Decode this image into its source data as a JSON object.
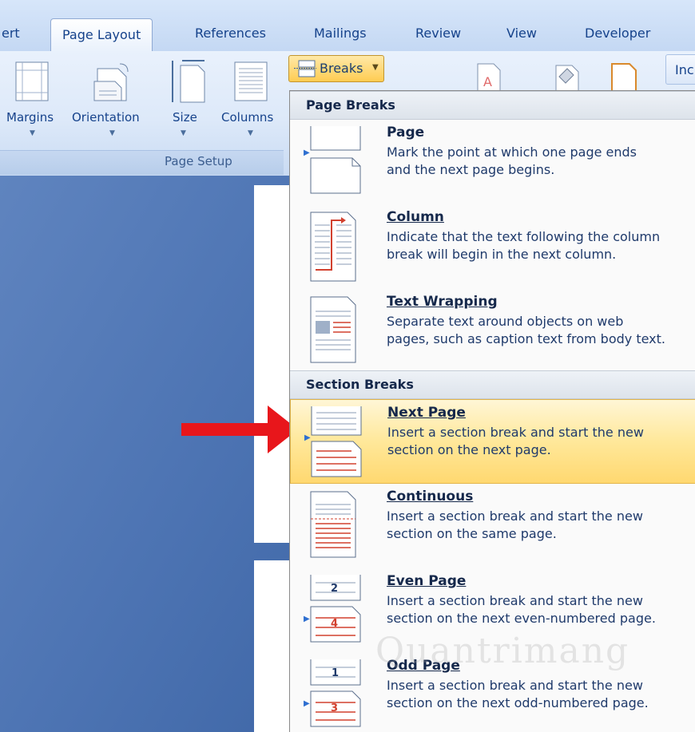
{
  "tabs": {
    "insert_partial": "ert",
    "page_layout": "Page Layout",
    "references": "References",
    "mailings": "Mailings",
    "review": "Review",
    "view": "View",
    "developer": "Developer"
  },
  "ribbon": {
    "margins": "Margins",
    "orientation": "Orientation",
    "size": "Size",
    "columns": "Columns",
    "group_name": "Page Setup",
    "breaks": "Breaks",
    "indent_partial": "Inc"
  },
  "menu": {
    "page_breaks_header": "Page Breaks",
    "section_breaks_header": "Section Breaks",
    "items": [
      {
        "title": "Page",
        "desc_1": "Mark the point at which one page ends",
        "desc_2": "and the next page begins."
      },
      {
        "title": "Column",
        "desc_1": "Indicate that the text following the column",
        "desc_2": "break will begin in the next column."
      },
      {
        "title": "Text Wrapping",
        "desc_1": "Separate text around objects on web",
        "desc_2": "pages, such as caption text from body text."
      },
      {
        "title": "Next Page",
        "desc_1": "Insert a section break and start the new",
        "desc_2": "section on the next page."
      },
      {
        "title": "Continuous",
        "desc_1": "Insert a section break and start the new",
        "desc_2": "section on the same page."
      },
      {
        "title": "Even Page",
        "desc_1": "Insert a section break and start the new",
        "desc_2": "section on the next even-numbered page."
      },
      {
        "title": "Odd Page",
        "desc_1": "Insert a section break and start the new",
        "desc_2": "section on the next odd-numbered page."
      }
    ],
    "even_icon_numbers": [
      "2",
      "4"
    ],
    "odd_icon_numbers": [
      "1",
      "3"
    ]
  },
  "watermark": "Quantrimang",
  "colors": {
    "highlight": "#ffe89a",
    "arrow": "#e8161b",
    "tab_text": "#15428b"
  }
}
